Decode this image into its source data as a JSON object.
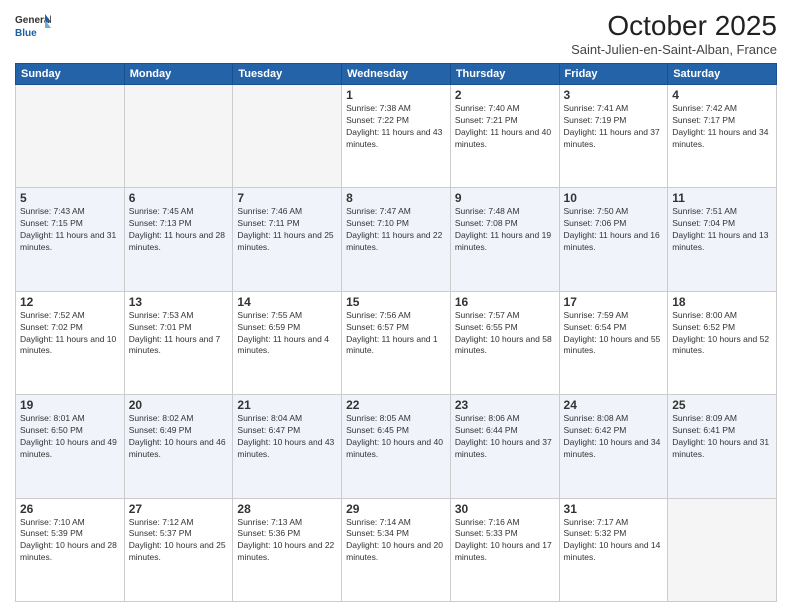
{
  "header": {
    "logo_line1": "General",
    "logo_line2": "Blue",
    "month": "October 2025",
    "location": "Saint-Julien-en-Saint-Alban, France"
  },
  "days_of_week": [
    "Sunday",
    "Monday",
    "Tuesday",
    "Wednesday",
    "Thursday",
    "Friday",
    "Saturday"
  ],
  "weeks": [
    [
      {
        "day": "",
        "sunrise": "",
        "sunset": "",
        "daylight": "",
        "empty": true
      },
      {
        "day": "",
        "sunrise": "",
        "sunset": "",
        "daylight": "",
        "empty": true
      },
      {
        "day": "",
        "sunrise": "",
        "sunset": "",
        "daylight": "",
        "empty": true
      },
      {
        "day": "1",
        "sunrise": "Sunrise: 7:38 AM",
        "sunset": "Sunset: 7:22 PM",
        "daylight": "Daylight: 11 hours and 43 minutes."
      },
      {
        "day": "2",
        "sunrise": "Sunrise: 7:40 AM",
        "sunset": "Sunset: 7:21 PM",
        "daylight": "Daylight: 11 hours and 40 minutes."
      },
      {
        "day": "3",
        "sunrise": "Sunrise: 7:41 AM",
        "sunset": "Sunset: 7:19 PM",
        "daylight": "Daylight: 11 hours and 37 minutes."
      },
      {
        "day": "4",
        "sunrise": "Sunrise: 7:42 AM",
        "sunset": "Sunset: 7:17 PM",
        "daylight": "Daylight: 11 hours and 34 minutes."
      }
    ],
    [
      {
        "day": "5",
        "sunrise": "Sunrise: 7:43 AM",
        "sunset": "Sunset: 7:15 PM",
        "daylight": "Daylight: 11 hours and 31 minutes."
      },
      {
        "day": "6",
        "sunrise": "Sunrise: 7:45 AM",
        "sunset": "Sunset: 7:13 PM",
        "daylight": "Daylight: 11 hours and 28 minutes."
      },
      {
        "day": "7",
        "sunrise": "Sunrise: 7:46 AM",
        "sunset": "Sunset: 7:11 PM",
        "daylight": "Daylight: 11 hours and 25 minutes."
      },
      {
        "day": "8",
        "sunrise": "Sunrise: 7:47 AM",
        "sunset": "Sunset: 7:10 PM",
        "daylight": "Daylight: 11 hours and 22 minutes."
      },
      {
        "day": "9",
        "sunrise": "Sunrise: 7:48 AM",
        "sunset": "Sunset: 7:08 PM",
        "daylight": "Daylight: 11 hours and 19 minutes."
      },
      {
        "day": "10",
        "sunrise": "Sunrise: 7:50 AM",
        "sunset": "Sunset: 7:06 PM",
        "daylight": "Daylight: 11 hours and 16 minutes."
      },
      {
        "day": "11",
        "sunrise": "Sunrise: 7:51 AM",
        "sunset": "Sunset: 7:04 PM",
        "daylight": "Daylight: 11 hours and 13 minutes."
      }
    ],
    [
      {
        "day": "12",
        "sunrise": "Sunrise: 7:52 AM",
        "sunset": "Sunset: 7:02 PM",
        "daylight": "Daylight: 11 hours and 10 minutes."
      },
      {
        "day": "13",
        "sunrise": "Sunrise: 7:53 AM",
        "sunset": "Sunset: 7:01 PM",
        "daylight": "Daylight: 11 hours and 7 minutes."
      },
      {
        "day": "14",
        "sunrise": "Sunrise: 7:55 AM",
        "sunset": "Sunset: 6:59 PM",
        "daylight": "Daylight: 11 hours and 4 minutes."
      },
      {
        "day": "15",
        "sunrise": "Sunrise: 7:56 AM",
        "sunset": "Sunset: 6:57 PM",
        "daylight": "Daylight: 11 hours and 1 minute."
      },
      {
        "day": "16",
        "sunrise": "Sunrise: 7:57 AM",
        "sunset": "Sunset: 6:55 PM",
        "daylight": "Daylight: 10 hours and 58 minutes."
      },
      {
        "day": "17",
        "sunrise": "Sunrise: 7:59 AM",
        "sunset": "Sunset: 6:54 PM",
        "daylight": "Daylight: 10 hours and 55 minutes."
      },
      {
        "day": "18",
        "sunrise": "Sunrise: 8:00 AM",
        "sunset": "Sunset: 6:52 PM",
        "daylight": "Daylight: 10 hours and 52 minutes."
      }
    ],
    [
      {
        "day": "19",
        "sunrise": "Sunrise: 8:01 AM",
        "sunset": "Sunset: 6:50 PM",
        "daylight": "Daylight: 10 hours and 49 minutes."
      },
      {
        "day": "20",
        "sunrise": "Sunrise: 8:02 AM",
        "sunset": "Sunset: 6:49 PM",
        "daylight": "Daylight: 10 hours and 46 minutes."
      },
      {
        "day": "21",
        "sunrise": "Sunrise: 8:04 AM",
        "sunset": "Sunset: 6:47 PM",
        "daylight": "Daylight: 10 hours and 43 minutes."
      },
      {
        "day": "22",
        "sunrise": "Sunrise: 8:05 AM",
        "sunset": "Sunset: 6:45 PM",
        "daylight": "Daylight: 10 hours and 40 minutes."
      },
      {
        "day": "23",
        "sunrise": "Sunrise: 8:06 AM",
        "sunset": "Sunset: 6:44 PM",
        "daylight": "Daylight: 10 hours and 37 minutes."
      },
      {
        "day": "24",
        "sunrise": "Sunrise: 8:08 AM",
        "sunset": "Sunset: 6:42 PM",
        "daylight": "Daylight: 10 hours and 34 minutes."
      },
      {
        "day": "25",
        "sunrise": "Sunrise: 8:09 AM",
        "sunset": "Sunset: 6:41 PM",
        "daylight": "Daylight: 10 hours and 31 minutes."
      }
    ],
    [
      {
        "day": "26",
        "sunrise": "Sunrise: 7:10 AM",
        "sunset": "Sunset: 5:39 PM",
        "daylight": "Daylight: 10 hours and 28 minutes."
      },
      {
        "day": "27",
        "sunrise": "Sunrise: 7:12 AM",
        "sunset": "Sunset: 5:37 PM",
        "daylight": "Daylight: 10 hours and 25 minutes."
      },
      {
        "day": "28",
        "sunrise": "Sunrise: 7:13 AM",
        "sunset": "Sunset: 5:36 PM",
        "daylight": "Daylight: 10 hours and 22 minutes."
      },
      {
        "day": "29",
        "sunrise": "Sunrise: 7:14 AM",
        "sunset": "Sunset: 5:34 PM",
        "daylight": "Daylight: 10 hours and 20 minutes."
      },
      {
        "day": "30",
        "sunrise": "Sunrise: 7:16 AM",
        "sunset": "Sunset: 5:33 PM",
        "daylight": "Daylight: 10 hours and 17 minutes."
      },
      {
        "day": "31",
        "sunrise": "Sunrise: 7:17 AM",
        "sunset": "Sunset: 5:32 PM",
        "daylight": "Daylight: 10 hours and 14 minutes."
      },
      {
        "day": "",
        "sunrise": "",
        "sunset": "",
        "daylight": "",
        "empty": true
      }
    ]
  ]
}
